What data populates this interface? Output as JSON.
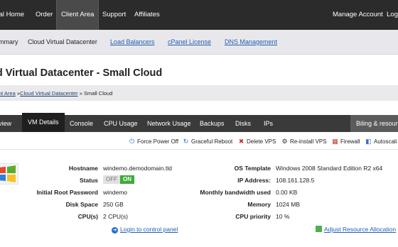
{
  "topnav": {
    "items": [
      "tal Home",
      "Order",
      "Client Area",
      "Support",
      "Affiliates"
    ],
    "right": [
      "Manage Account",
      "Log"
    ]
  },
  "subnav": {
    "items": [
      "mmary",
      "Cloud Virtual Datacenter",
      "Load Balancers",
      "cPanel License",
      "DNS Management"
    ]
  },
  "page_title": "ud Virtual Datacenter - Small Cloud",
  "breadcrumb": {
    "client_area": "nt Area",
    "sep1": " »",
    "cloud": "Cloud Virtual Datacenter",
    "sep2": " » ",
    "current": "Small Cloud"
  },
  "tabs": [
    "view",
    "VM Details",
    "Console",
    "CPU Usage",
    "Network Usage",
    "Backups",
    "Disks",
    "IPs"
  ],
  "right_tab": "Biling & resourc",
  "actions": [
    {
      "icon": "power-icon",
      "glyph": "⏻",
      "label": "Force Power Off"
    },
    {
      "icon": "graceful-shutdown-icon",
      "glyph": "↻",
      "label": "Graceful Reboot"
    },
    {
      "icon": "delete-icon",
      "glyph": "✖",
      "label": "Delete VPS"
    },
    {
      "icon": "reinstall-icon",
      "glyph": "⚙",
      "label": "Re-install VPS"
    },
    {
      "icon": "firewall-icon",
      "glyph": "▦",
      "label": "Firewall"
    },
    {
      "icon": "autoscale-icon",
      "glyph": "◧",
      "label": "Autoscali"
    }
  ],
  "colors": {
    "action_power": "#1f6fd0",
    "action_delete": "#d03030",
    "action_firewall": "#c0392b",
    "badge_on": "#3cab3c"
  },
  "details_left": {
    "hostname_label": "Hostname",
    "hostname": "windemo.demodomain.tld",
    "status_label": "Status",
    "status_off": "OFF",
    "status_on": "ON",
    "root_pw_label": "Initial Root Password",
    "root_pw": "windemo",
    "disk_label": "Disk Space",
    "disk": "250 GB",
    "cpu_label": "CPU(s)",
    "cpu": "2 CPU(s)"
  },
  "details_right": {
    "os_label": "OS Template",
    "os": "Windows 2008 Standard Edition R2 x64",
    "ip_label": "IP Address:",
    "ip": "108.161.128.5",
    "bw_label": "Monthly bandwidth used",
    "bw": "0.00 KB",
    "mem_label": "Memory",
    "mem": "1024 MB",
    "prio_label": "CPU priority",
    "prio": "10 %"
  },
  "links": {
    "login": "Login to control panel",
    "adjust": "Adjust Resource Allocation"
  }
}
